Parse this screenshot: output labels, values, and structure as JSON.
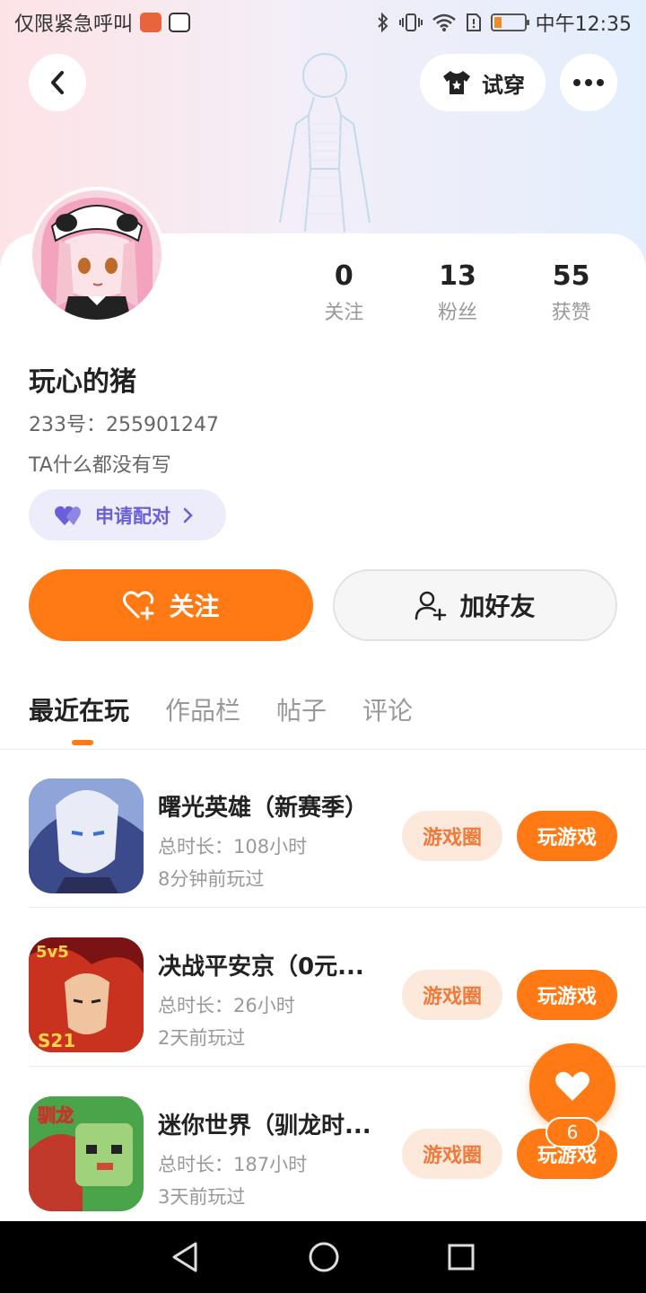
{
  "status_bar": {
    "left_text": "仅限紧急呼叫",
    "time": "中午12:35"
  },
  "top_bar": {
    "try_on_label": "试穿"
  },
  "profile": {
    "stats": [
      {
        "value": "0",
        "label": "关注"
      },
      {
        "value": "13",
        "label": "粉丝"
      },
      {
        "value": "55",
        "label": "获赞"
      }
    ],
    "name": "玩心的猪",
    "id_text": "233号：255901247",
    "bio": "TA什么都没有写",
    "pair_label": "申请配对"
  },
  "actions": {
    "follow_label": "关注",
    "add_friend_label": "加好友"
  },
  "tabs": [
    {
      "label": "最近在玩",
      "active": true
    },
    {
      "label": "作品栏",
      "active": false
    },
    {
      "label": "帖子",
      "active": false
    },
    {
      "label": "评论",
      "active": false
    }
  ],
  "games": [
    {
      "title": "曙光英雄（新赛季）",
      "total_time": "总时长：108小时",
      "last_played": "8分钟前玩过",
      "circle_label": "游戏圈",
      "play_label": "玩游戏"
    },
    {
      "title": "决战平安京（0元...",
      "total_time": "总时长：26小时",
      "last_played": "2天前玩过",
      "circle_label": "游戏圈",
      "play_label": "玩游戏"
    },
    {
      "title": "迷你世界（驯龙时...",
      "total_time": "总时长：187小时",
      "last_played": "3天前玩过",
      "circle_label": "游戏圈",
      "play_label": "玩游戏"
    }
  ],
  "like_fab": {
    "count": "6"
  },
  "colors": {
    "accent": "#ff7a14",
    "pair_purple": "#6a5fd6"
  }
}
